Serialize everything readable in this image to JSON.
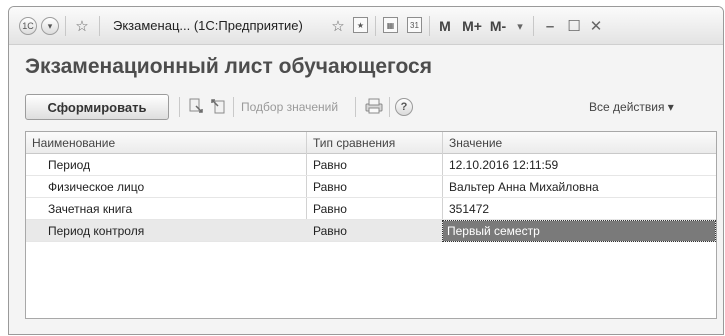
{
  "window": {
    "title": "Экзаменац... (1С:Предприятие)",
    "memory_buttons": [
      "M",
      "M+",
      "M-"
    ]
  },
  "form": {
    "title": "Экзаменационный лист обучающегося"
  },
  "toolbar": {
    "generate_label": "Сформировать",
    "select_values_label": "Подбор значений",
    "help_label": "?",
    "all_actions_label": "Все действия ▾"
  },
  "table": {
    "headers": [
      "Наименование",
      "Тип сравнения",
      "Значение"
    ],
    "rows": [
      {
        "name": "Период",
        "comparison": "Равно",
        "value": "12.10.2016 12:11:59"
      },
      {
        "name": "Физическое лицо",
        "comparison": "Равно",
        "value": "Вальтер Анна Михайловна"
      },
      {
        "name": "Зачетная книга",
        "comparison": "Равно",
        "value": "351472"
      },
      {
        "name": "Период контроля",
        "comparison": "Равно",
        "value": "Первый семестр"
      }
    ],
    "selected_row": 3
  }
}
